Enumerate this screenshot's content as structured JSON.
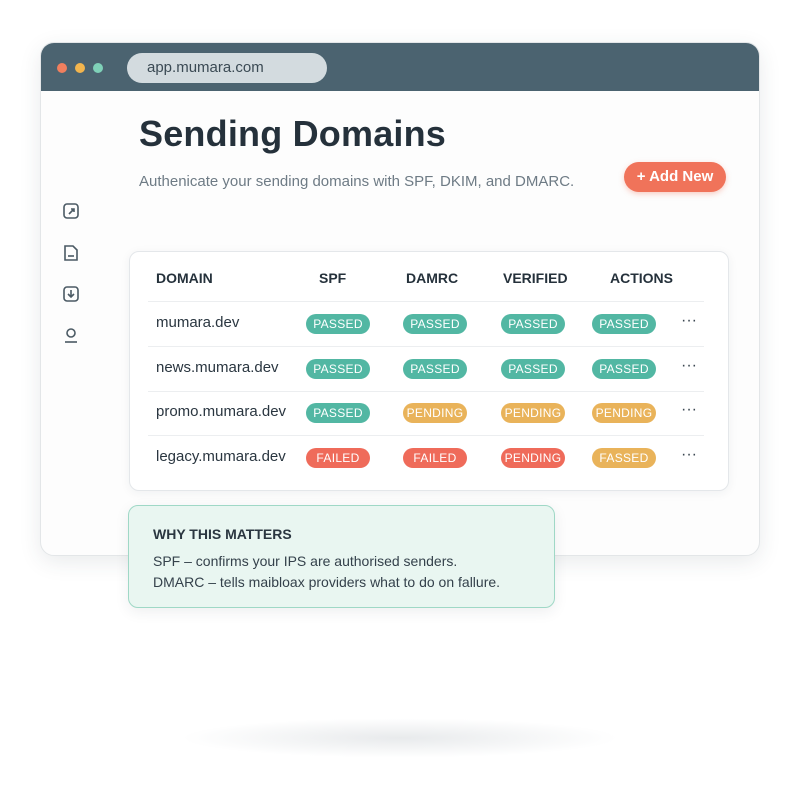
{
  "browser": {
    "url": "app.mumara.com"
  },
  "page": {
    "title": "Sending Domains",
    "subtitle": "Authenicate your sending domains with SPF, DKIM, and DMARC.",
    "add_button": "+ Add New"
  },
  "sidebar": {
    "icons": [
      "share-icon",
      "document-icon",
      "import-icon",
      "user-icon"
    ]
  },
  "table": {
    "headers": [
      "DOMAIN",
      "SPF",
      "DAMRC",
      "VERIFIED",
      "ACTIONS"
    ],
    "rows": [
      {
        "domain": "mumara.dev",
        "spf": "PASSED",
        "damrc": "PASSED",
        "verified": "PASSED",
        "actions": "PASSED",
        "more": "···"
      },
      {
        "domain": "news.mumara.dev",
        "spf": "PASSED",
        "damrc": "PASSED",
        "verified": "PASSED",
        "actions": "PASSED",
        "more": "···"
      },
      {
        "domain": "promo.mumara.dev",
        "spf": "PASSED",
        "damrc": "PENDING",
        "verified": "PENDING",
        "actions": "PENDING",
        "more": "···"
      },
      {
        "domain": "legacy.mumara.dev",
        "spf": "FAILED",
        "damrc": "FAILED",
        "verified": "PENDING",
        "actions": "FASSED",
        "more": "···"
      }
    ]
  },
  "note": {
    "title": "WHY THIS MATTERS",
    "line1": "SPF – confirms your IPS are authorised senders.",
    "line2": "DMARC – tells maibloax providers what to do on fallure."
  },
  "colors": {
    "titlebar": "#4b6370",
    "accent": "#f0735a",
    "passed": "#52b7a3",
    "pending": "#e9b35a",
    "failed": "#ef6b5a",
    "note_bg": "#e9f6f1"
  }
}
